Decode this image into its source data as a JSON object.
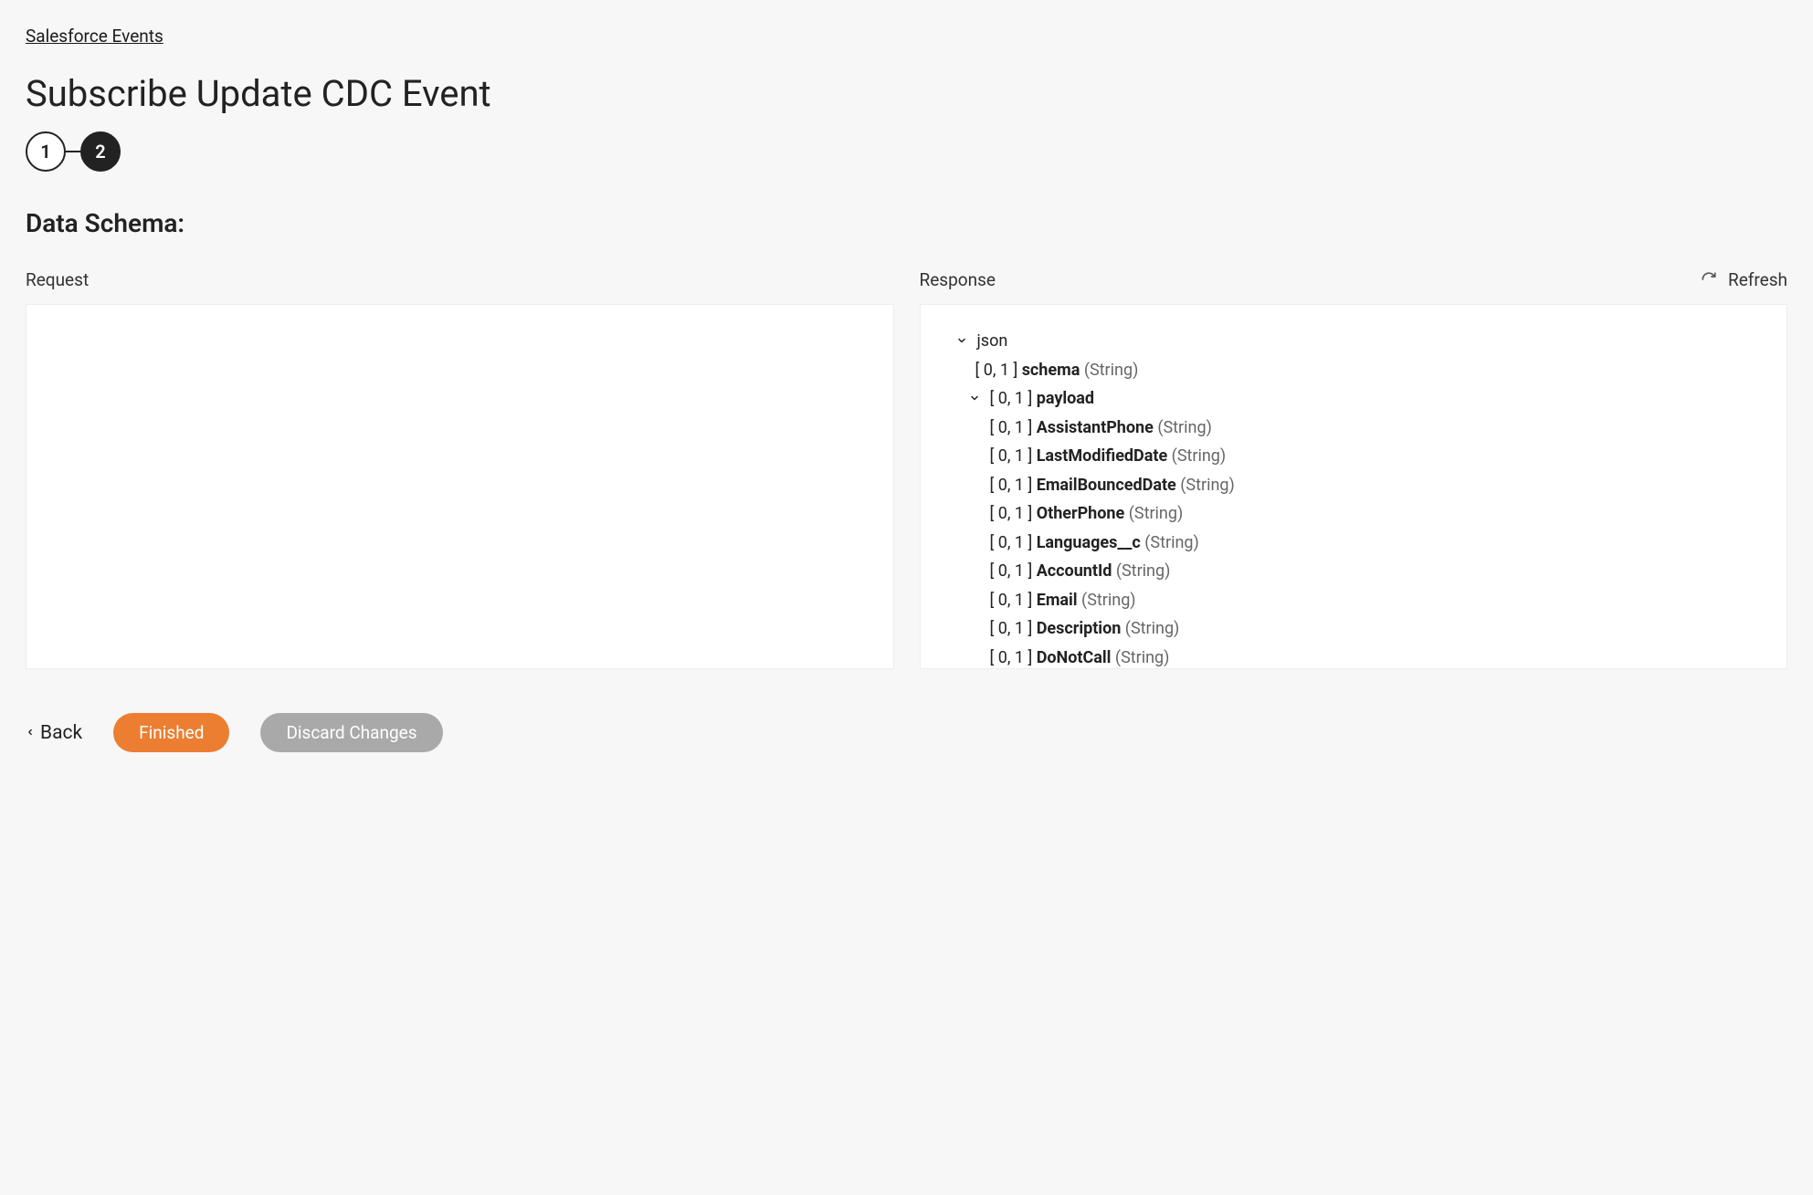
{
  "breadcrumb": {
    "label": "Salesforce Events"
  },
  "page_title": "Subscribe Update CDC Event",
  "stepper": {
    "step1": "1",
    "step2": "2"
  },
  "section_label": "Data Schema:",
  "columns": {
    "request_label": "Request",
    "response_label": "Response",
    "refresh_label": "Refresh"
  },
  "tree": {
    "root_label": "json",
    "schema": {
      "occ": "[ 0, 1 ]",
      "name": "schema",
      "type": "(String)"
    },
    "payload": {
      "occ": "[ 0, 1 ]",
      "name": "payload"
    },
    "fields": [
      {
        "occ": "[ 0, 1 ]",
        "name": "AssistantPhone",
        "type": "(String)"
      },
      {
        "occ": "[ 0, 1 ]",
        "name": "LastModifiedDate",
        "type": "(String)"
      },
      {
        "occ": "[ 0, 1 ]",
        "name": "EmailBouncedDate",
        "type": "(String)"
      },
      {
        "occ": "[ 0, 1 ]",
        "name": "OtherPhone",
        "type": "(String)"
      },
      {
        "occ": "[ 0, 1 ]",
        "name": "Languages__c",
        "type": "(String)"
      },
      {
        "occ": "[ 0, 1 ]",
        "name": "AccountId",
        "type": "(String)"
      },
      {
        "occ": "[ 0, 1 ]",
        "name": "Email",
        "type": "(String)"
      },
      {
        "occ": "[ 0, 1 ]",
        "name": "Description",
        "type": "(String)"
      },
      {
        "occ": "[ 0, 1 ]",
        "name": "DoNotCall",
        "type": "(String)"
      }
    ]
  },
  "footer": {
    "back_label": "Back",
    "finished_label": "Finished",
    "discard_label": "Discard Changes"
  }
}
